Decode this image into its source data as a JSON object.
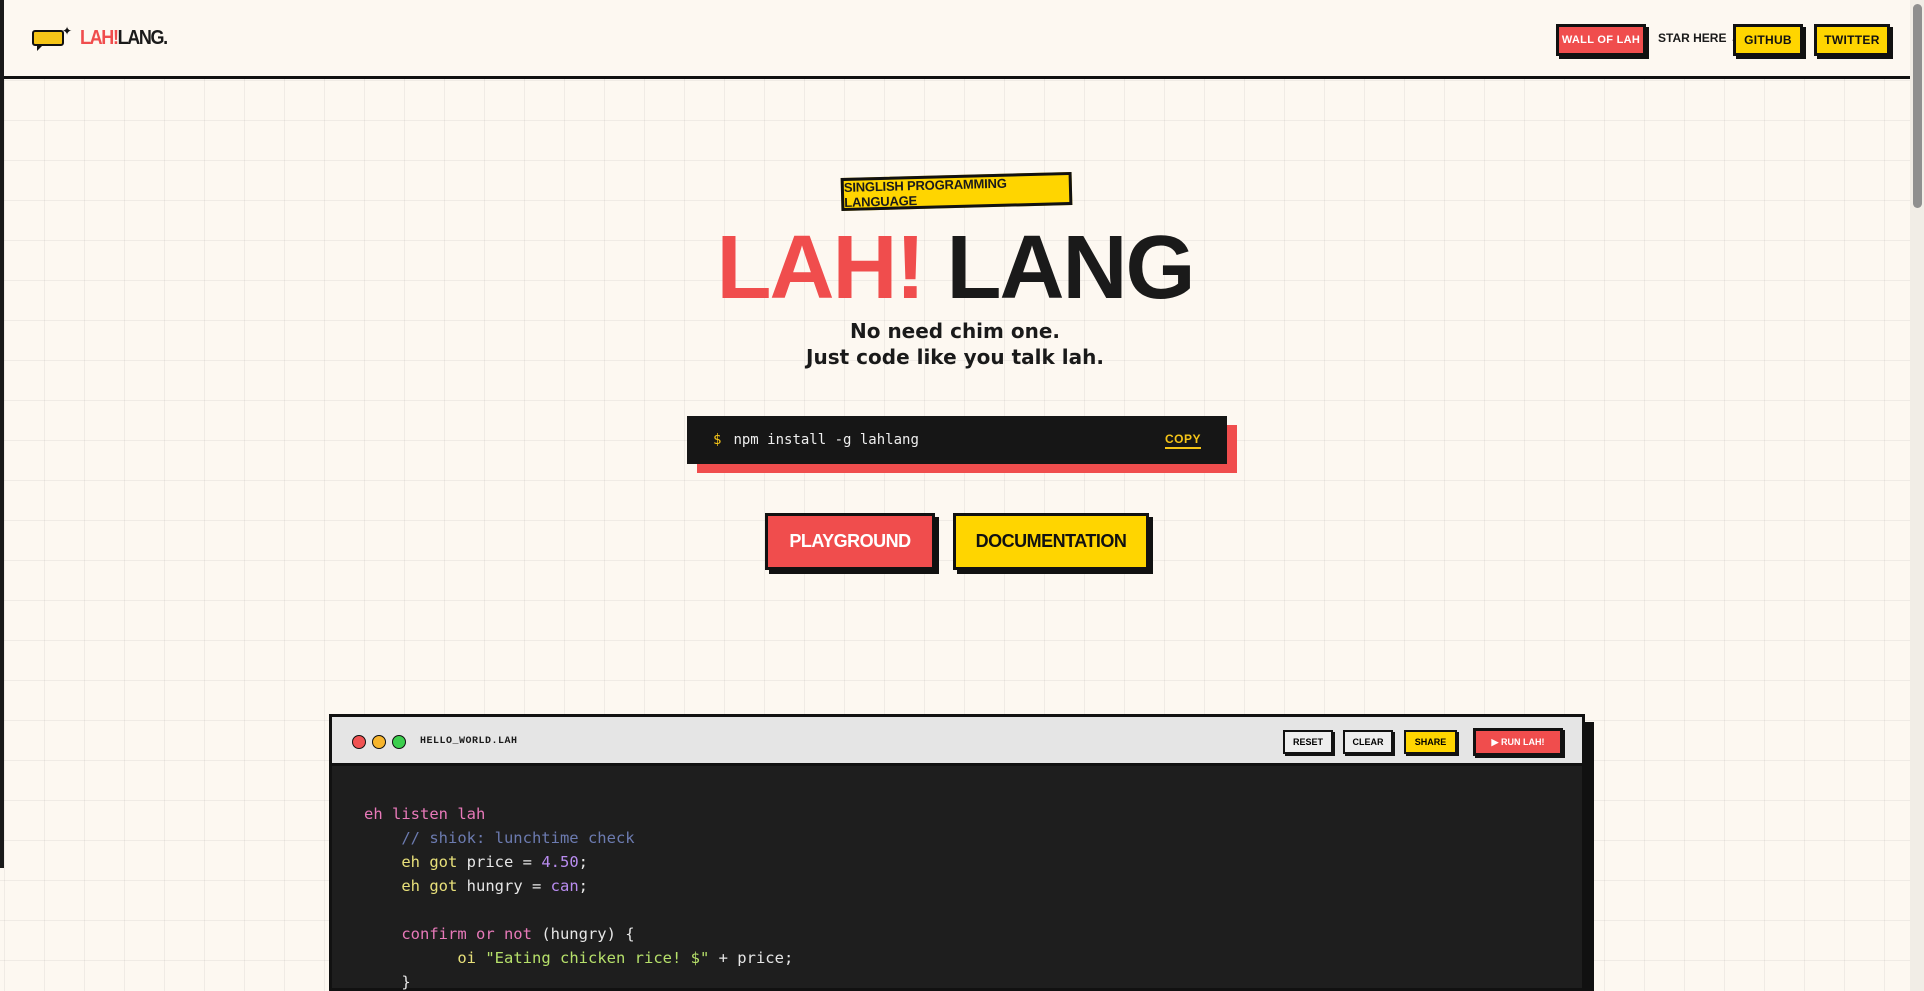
{
  "header": {
    "logo_badge": "!!!",
    "logo_red": "LAH!",
    "logo_dark": "LANG.",
    "nav": {
      "wall": "WALL OF LAH",
      "star_here": "STAR HERE →",
      "github": "GITHUB",
      "twitter": "TWITTER"
    }
  },
  "hero": {
    "tag": "SINGLISH PROGRAMMING LANGUAGE",
    "title_red": "LAH!",
    "title_dark": "LANG",
    "subtitle_line1": "No need chim one.",
    "subtitle_line2": "Just code like you talk lah."
  },
  "install": {
    "prompt": "$",
    "command": "npm install -g lahlang",
    "copy_label": "COPY"
  },
  "cta": {
    "playground": "PLAYGROUND",
    "documentation": "DOCUMENTATION"
  },
  "editor": {
    "file_name": "HELLO_WORLD.LAH",
    "buttons": {
      "reset": "RESET",
      "clear": "CLEAR",
      "share": "SHARE",
      "run": "▶ RUN LAH!"
    },
    "code": {
      "l1": "eh listen lah",
      "l2": "// shiok: lunchtime check",
      "l3_kw": "eh got",
      "l3_rest": " price = ",
      "l3_num": "4.50",
      "l3_end": ";",
      "l4_kw": "eh got",
      "l4_rest": " hungry = ",
      "l4_val": "can",
      "l4_end": ";",
      "l6_kw": "confirm or not",
      "l6_rest": " (hungry) {",
      "l7_kw": "oi",
      "l7_str": "\"Eating chicken rice! $\"",
      "l7_rest": " + price;",
      "l8": "}"
    }
  },
  "colors": {
    "accent_red": "#f04d4d",
    "accent_yellow": "#ffd500",
    "background": "#fdf8f1",
    "ink": "#111111"
  }
}
